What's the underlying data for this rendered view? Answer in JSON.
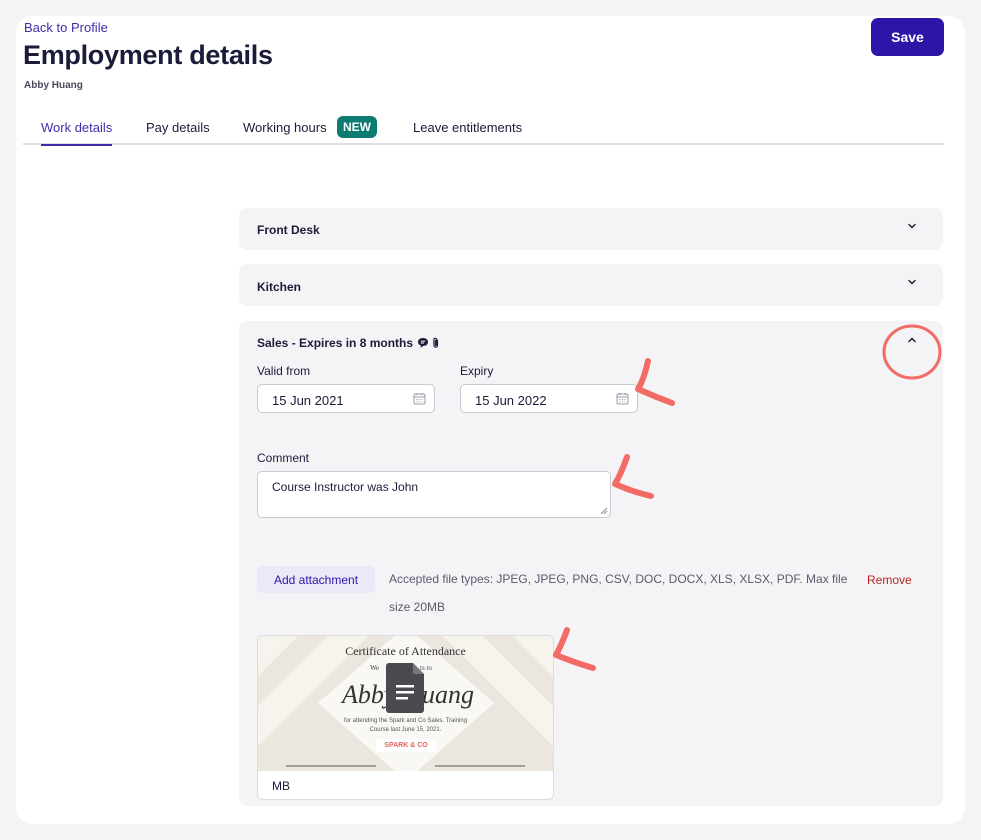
{
  "header": {
    "back_link": "Back to Profile",
    "title": "Employment details",
    "employee_name": "Abby Huang",
    "save_label": "Save"
  },
  "tabs": [
    {
      "label": "Work details",
      "active": true
    },
    {
      "label": "Pay details",
      "active": false
    },
    {
      "label": "Working hours",
      "active": false,
      "badge": "NEW"
    },
    {
      "label": "Leave entitlements",
      "active": false
    }
  ],
  "sections": [
    {
      "title": "Front Desk",
      "expanded": false
    },
    {
      "title": "Kitchen",
      "expanded": false
    },
    {
      "title": "Sales - Expires in 8 months",
      "expanded": true,
      "icons": [
        "comment-icon",
        "paperclip-icon"
      ],
      "valid_from_label": "Valid from",
      "valid_from_value": "15 Jun 2021",
      "expiry_label": "Expiry",
      "expiry_value": "15 Jun 2022",
      "comment_label": "Comment",
      "comment_value": "Course Instructor was John",
      "add_attachment_label": "Add attachment",
      "accepted_types": "Accepted file types: JPEG, JPEG, PNG, CSV, DOC, DOCX, XLS, XLSX, PDF. Max file size 20MB",
      "remove_label": "Remove",
      "attachment": {
        "cert_title": "Certificate of Attendance",
        "cert_line1": "We",
        "cert_line1b": "ts to",
        "cert_name_a": "Abby",
        "cert_name_b": "uang",
        "cert_body1": "for attending the Spark and Co Sales. Training",
        "cert_body2": "Course last June 15, 2021.",
        "cert_brand": "SPARK & CO",
        "size_text": "MB"
      }
    }
  ],
  "colors": {
    "primary": "#2f14a8",
    "badge": "#0e7b73",
    "annotation": "#f26b65",
    "remove": "#b3261e"
  }
}
